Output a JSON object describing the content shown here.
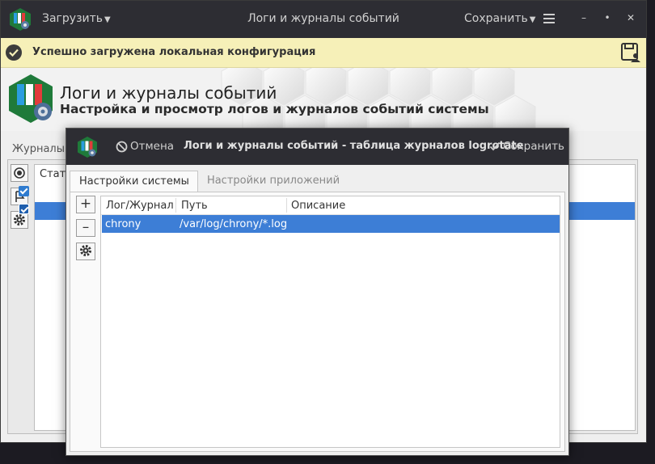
{
  "titlebar": {
    "load_menu": "Загрузить",
    "title": "Логи и журналы событий",
    "save_menu": "Сохранить",
    "minimize": "–",
    "restore": "•",
    "close": "✕"
  },
  "notification": {
    "text": "Успешно загружена локальная конфигурация"
  },
  "header": {
    "title": "Логи и журналы событий",
    "subtitle": "Настройка и просмотр логов и журналов событий системы"
  },
  "background": {
    "tab_label": "Журналы",
    "table_header": "Стат"
  },
  "dialog": {
    "cancel_label": "Отмена",
    "title": "Логи и журналы событий - таблица журналов logrotate",
    "save_label": "Сохранить",
    "tabs": [
      {
        "label": "Настройки системы",
        "active": true
      },
      {
        "label": "Настройки приложений",
        "active": false
      }
    ],
    "side_buttons": {
      "add": "+",
      "remove": "–"
    },
    "table": {
      "columns": [
        "Лог/Журнал",
        "Путь",
        "Описание"
      ],
      "rows": [
        {
          "log": "chrony",
          "path": "/var/log/chrony/*.log",
          "description": "",
          "selected": true
        }
      ]
    }
  },
  "colors": {
    "titlebar": "#2d2d33",
    "notification": "#f6f0b8",
    "selection": "#3d7ed6",
    "success": "#3c3c3c"
  }
}
